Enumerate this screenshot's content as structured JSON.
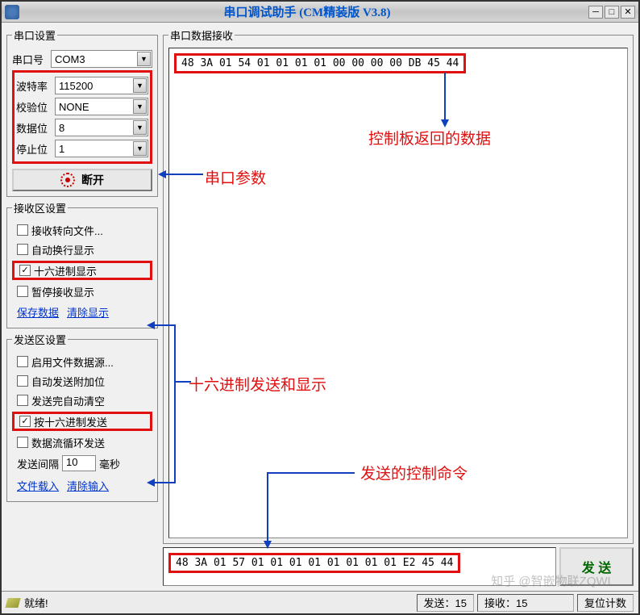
{
  "title": "串口调试助手 (CM精装版 V3.8)",
  "serial_settings": {
    "legend": "串口设置",
    "port_label": "串口号",
    "port_value": "COM3",
    "baud_label": "波特率",
    "baud_value": "115200",
    "parity_label": "校验位",
    "parity_value": "NONE",
    "data_label": "数据位",
    "data_value": "8",
    "stop_label": "停止位",
    "stop_value": "1",
    "disconnect_btn": "断开"
  },
  "recv_settings": {
    "legend": "接收区设置",
    "to_file": "接收转向文件...",
    "auto_wrap": "自动换行显示",
    "hex_display": "十六进制显示",
    "pause_recv": "暂停接收显示",
    "save_link": "保存数据",
    "clear_link": "清除显示"
  },
  "send_settings": {
    "legend": "发送区设置",
    "file_source": "启用文件数据源...",
    "auto_extra": "自动发送附加位",
    "auto_clear": "发送完自动清空",
    "hex_send": "按十六进制发送",
    "cycle_send": "数据流循环发送",
    "interval_label": "发送间隔",
    "interval_value": "10",
    "interval_unit": "毫秒",
    "file_link": "文件载入",
    "clear_input_link": "清除输入"
  },
  "recv_area": {
    "legend": "串口数据接收",
    "data": "48 3A 01 54 01 01 01 01 00 00 00 00 DB 45 44"
  },
  "send_area": {
    "data": "48 3A 01 57 01 01 01 01 01 01 01 01 E2 45 44",
    "send_btn": "发 送"
  },
  "status": {
    "ready": "就绪!",
    "sent_label": "发送：15",
    "recv_label": "接收：15",
    "reset_btn": "复位计数"
  },
  "annotations": {
    "returned_data": "控制板返回的数据",
    "serial_params": "串口参数",
    "hex_mode": "十六进制发送和显示",
    "sent_cmd": "发送的控制命令"
  },
  "watermark": "知乎 @智嵌物联ZQWL"
}
